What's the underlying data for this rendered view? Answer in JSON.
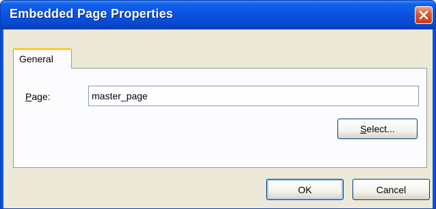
{
  "window": {
    "title": "Embedded Page Properties",
    "close_icon": "close-icon"
  },
  "tabs": [
    {
      "label": "General",
      "selected": true
    }
  ],
  "form": {
    "page_label_mnemonic": "P",
    "page_label_rest": "age:",
    "page_value": "master_page"
  },
  "buttons": {
    "select_mnemonic": "S",
    "select_rest": "elect...",
    "ok_label": "OK",
    "cancel_label": "Cancel"
  },
  "colors": {
    "titlebar": "#0a54e3",
    "tab_highlight": "#ffc73c",
    "close_button": "#e3582e"
  }
}
